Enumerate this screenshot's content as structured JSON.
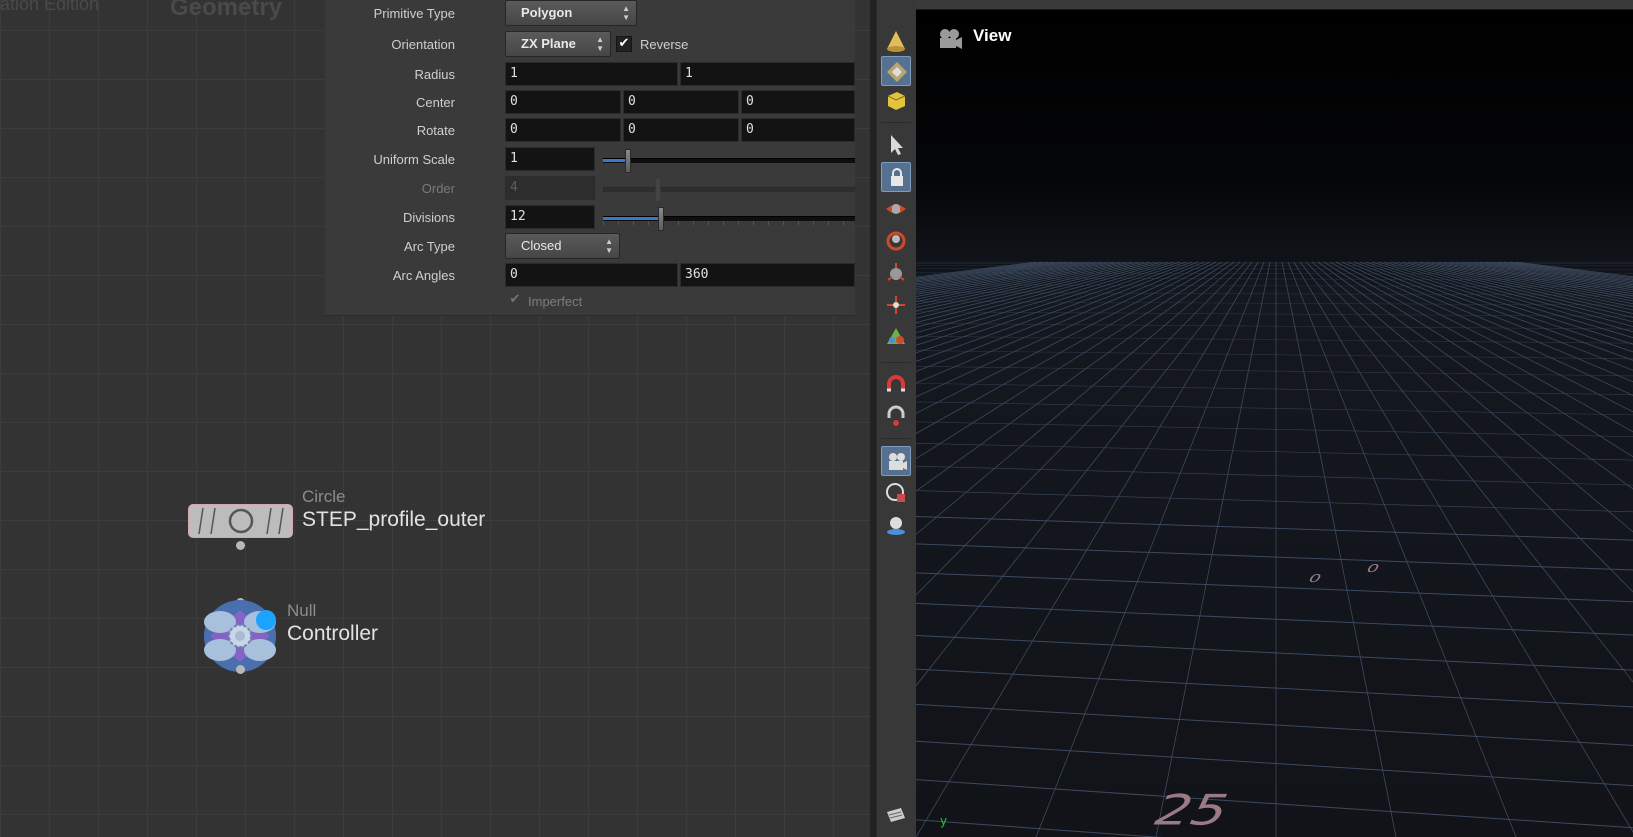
{
  "network": {
    "edition_text": "ation Edition",
    "geometry_title": "Geometry",
    "nodes": [
      {
        "type": "Circle",
        "name": "STEP_profile_outer"
      },
      {
        "type": "Null",
        "name": "Controller"
      }
    ]
  },
  "params": {
    "primitive_type": {
      "label": "Primitive Type",
      "value": "Polygon"
    },
    "orientation": {
      "label": "Orientation",
      "value": "ZX Plane",
      "reverse_label": "Reverse",
      "reverse_checked": true
    },
    "radius": {
      "label": "Radius",
      "values": [
        "1",
        "1"
      ]
    },
    "center": {
      "label": "Center",
      "values": [
        "0",
        "0",
        "0"
      ]
    },
    "rotate": {
      "label": "Rotate",
      "values": [
        "0",
        "0",
        "0"
      ]
    },
    "uniform_scale": {
      "label": "Uniform Scale",
      "value": "1",
      "slider_fraction": 0.1
    },
    "order": {
      "label": "Order",
      "value": "4",
      "slider_fraction": 0.22,
      "disabled": true
    },
    "divisions": {
      "label": "Divisions",
      "value": "12",
      "slider_fraction": 0.23
    },
    "arc_type": {
      "label": "Arc Type",
      "value": "Closed"
    },
    "arc_angles": {
      "label": "Arc Angles",
      "values": [
        "0",
        "360"
      ]
    },
    "imperfect": {
      "label": "Imperfect",
      "checked": true,
      "disabled": true
    }
  },
  "toolbar": {
    "tools": [
      "cone-icon",
      "diamond-select-icon",
      "box-icon",
      "pointer-icon",
      "lock-icon",
      "transform-icon",
      "rotate-icon",
      "handle-icon",
      "pose-icon",
      "scene-icon",
      "snap-magnet-icon",
      "snap-options-icon",
      "camera-icon",
      "display-options-icon",
      "light-icon",
      "notes-icon"
    ]
  },
  "viewport": {
    "title": "View",
    "axis_label": "y",
    "grid_labels": [
      "0",
      "0",
      "25"
    ],
    "colors": {
      "grid_line": "#3c4a5e",
      "label": "#9b7a86",
      "active_tool": "#56708f"
    }
  }
}
